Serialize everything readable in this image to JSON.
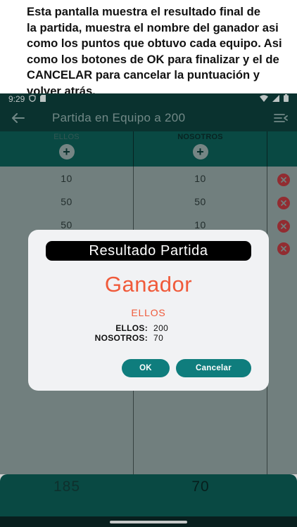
{
  "caption": {
    "line1": "Esta pantalla muestra el resultado final de",
    "line2": "la partida, muestra el nombre del ganador asi",
    "line3": "como los puntos que obtuvo cada equipo. Asi",
    "line4": "como los botones de OK para finalizar y el de",
    "line5": "CANCELAR para cancelar la puntuación y",
    "line6": "volver atrás."
  },
  "status_bar": {
    "time": "9:29",
    "icons": [
      "shield-icon",
      "sd-card-icon",
      "wifi-icon",
      "signal-icon",
      "battery-icon"
    ]
  },
  "app_bar": {
    "title": "Partida en Equipo a 200",
    "back_icon": "arrow-left-icon",
    "menu_icon": "menu-collapse-icon"
  },
  "teams": {
    "team1": "ELLOS",
    "team2": "NOSOTROS"
  },
  "rows": [
    {
      "team1": "10",
      "team2": "10"
    },
    {
      "team1": "50",
      "team2": "50"
    },
    {
      "team1": "50",
      "team2": "10"
    }
  ],
  "totals": {
    "team1": "185",
    "team2": "70"
  },
  "dialog": {
    "title": "Resultado Partida",
    "winner_heading": "Ganador",
    "winner_name": "ELLOS",
    "score1_label": "ELLOS:",
    "score1_value": "200",
    "score2_label": "NOSOTROS:",
    "score2_value": "70",
    "ok_label": "OK",
    "cancel_label": "Cancelar"
  },
  "colors": {
    "primary_dark": "#0d3d3a",
    "primary": "#0b5a52",
    "accent": "#f05a3a",
    "button": "#0f7d7d",
    "delete": "#b3363c"
  }
}
